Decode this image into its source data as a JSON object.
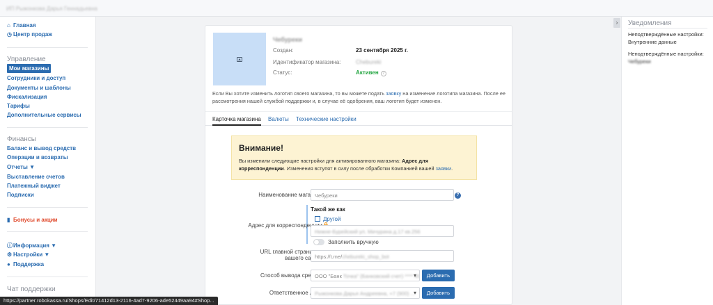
{
  "topbar": {
    "user_name": "ИП Рыжонкова Дарья Геннадьевна"
  },
  "sidebar": {
    "home": "Главная",
    "sales_center": "Центр продаж",
    "section_manage": "Управление",
    "my_shops": "Мои магазины",
    "staff": "Сотрудники и доступ",
    "docs": "Документы и шаблоны",
    "fiscal": "Фискализация",
    "tariffs": "Тарифы",
    "extra": "Дополнительные сервисы",
    "section_finance": "Финансы",
    "balance": "Баланс и вывод средств",
    "operations": "Операции и возвраты",
    "reports": "Отчеты ▼",
    "invoices": "Выставление счетов",
    "widget": "Платежный виджет",
    "subscriptions": "Подписки",
    "bonuses": "Бонусы и акции",
    "info": "Информация ▼",
    "settings": "Настройки ▼",
    "support": "Поддержка",
    "chat": "Чат поддержки"
  },
  "shop": {
    "name": "Чебуреки",
    "created_label": "Создан:",
    "created_value": "23 сентября 2025 г.",
    "id_label": "Идентификатор магазина:",
    "id_value": "Chebureki",
    "status_label": "Статус:",
    "status_value": "Активен",
    "status_help": "?",
    "notice_part1": "Если Вы хотите изменить логотип своего магазина, то вы можете подать ",
    "notice_link": "заявку",
    "notice_part2": " на изменение логотипа магазина. После ее рассмотрения нашей службой поддержки и, в случае её одобрения, ваш логотип будет изменен."
  },
  "tabs": [
    "Карточка магазина",
    "Валюты",
    "Технические настройки"
  ],
  "warning": {
    "title": "Внимание!",
    "text1": "Вы изменили следующие настройки для активированного магазина: ",
    "bold": "Адрес для корреспонденции",
    "text2": ". Изменения вступят в силу после обработки Компанией вашей ",
    "link": "заявки",
    "text3": "."
  },
  "form": {
    "name_label": "Наименование магазина",
    "name_value": "Чебуреки",
    "help": "?",
    "address_label": "Адрес для корреспонденции",
    "same_as": "Такой же как",
    "other": "Другой",
    "address_value": "Нижне-Бурейский ул. Мичурина д.17 кв.256",
    "fill_manual": "Заполнить вручную",
    "url_label_1": "URL главной страницы",
    "url_label_2": "вашего сайта",
    "url_prefix": "https://t.me/",
    "url_value": "chebureki_shop_bot",
    "payout_label": "Способ вывода средств",
    "payout_prefix": "ООО \"Банк ",
    "payout_value": "Точка\" (Банковский счет) **** 4521",
    "add_btn": "Добавить",
    "person_label": "Ответственное лицо",
    "person_value": "Рыжонкова Дарья Андреевна, +7 (900) ...",
    "add_btn2": "Добавить"
  },
  "right_panel": {
    "title": "Уведомления",
    "item1": "Неподтверждённые настройки:",
    "item1_link": "Внутренние данные",
    "item2": "Неподтверждённые настройки:",
    "item2_link": "Чебуреки"
  },
  "statusbar": {
    "url": "https://partner.robokassa.ru/Shops/Edit/71412d13-2116-4ad7-9206-ade52449aa94#Shop..."
  }
}
